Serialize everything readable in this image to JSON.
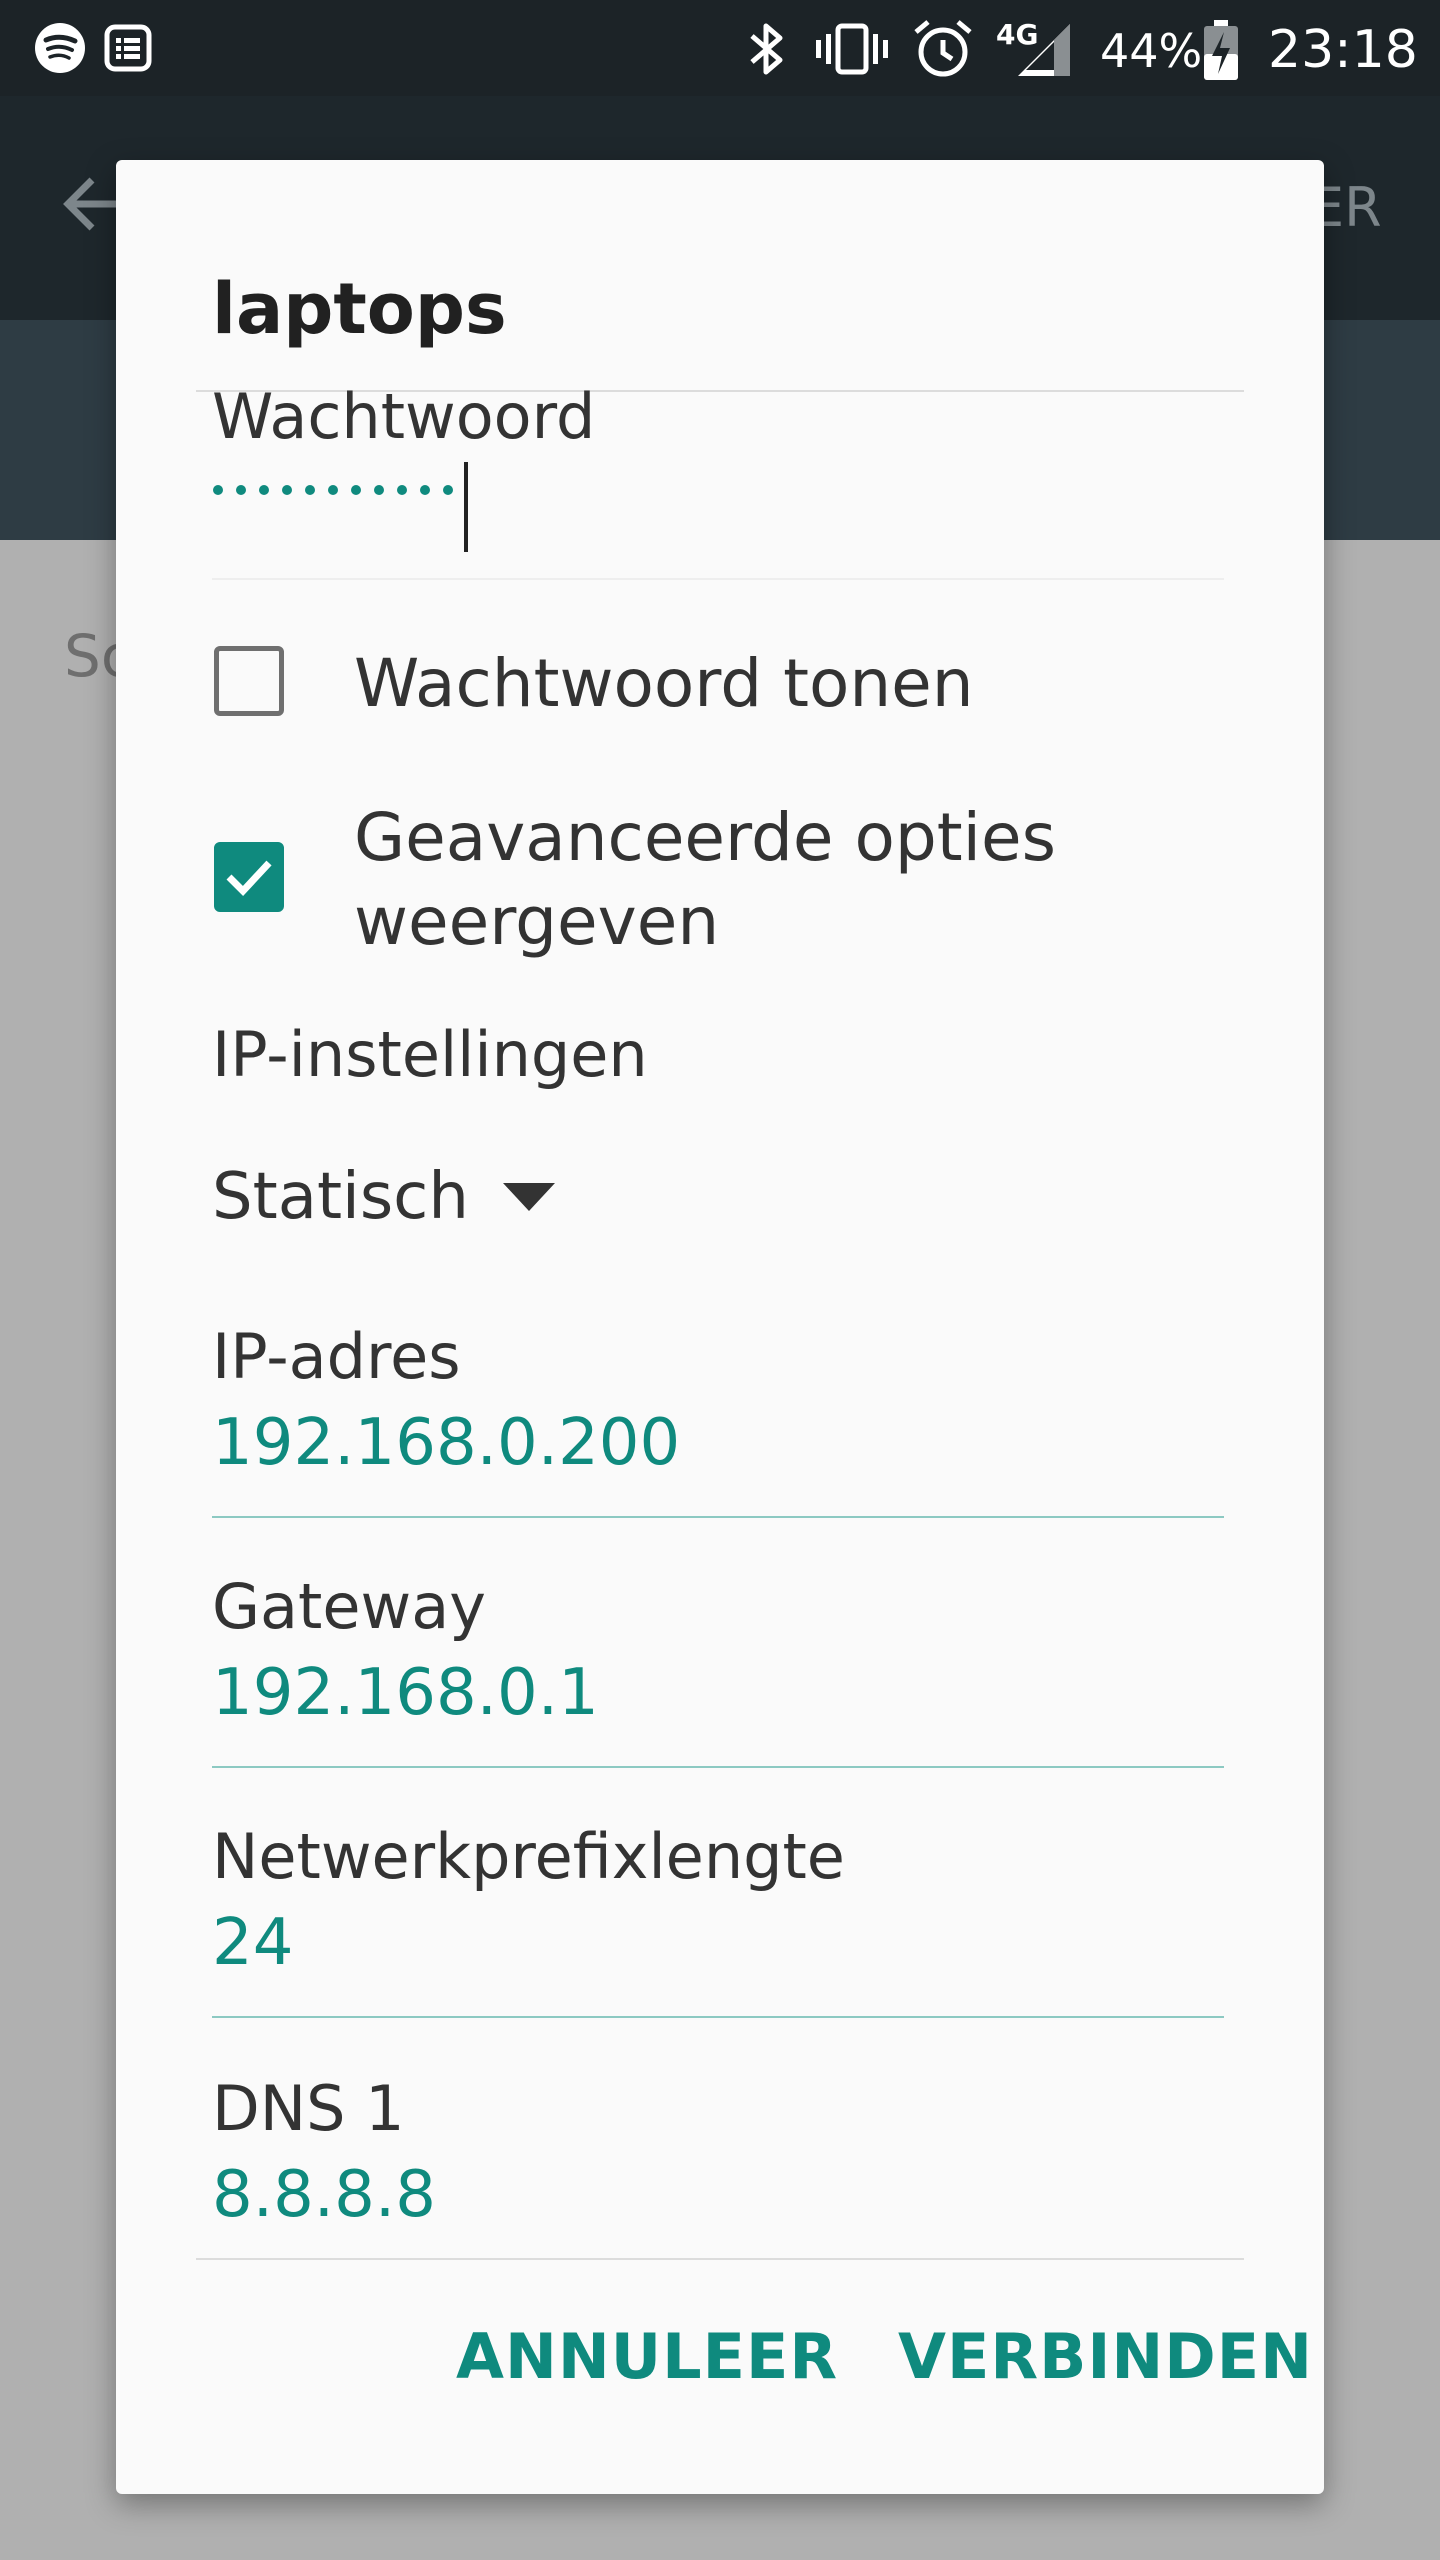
{
  "status_bar": {
    "battery": "44%",
    "time": "23:18",
    "network": "4G",
    "icons": [
      "spotify-icon",
      "notes-icon",
      "bluetooth-icon",
      "vibrate-icon",
      "alarm-icon",
      "signal-icon",
      "battery-charging-icon"
    ]
  },
  "app_bar": {
    "action_partial": "ER",
    "background_label_partial": "Sc"
  },
  "dialog": {
    "title": "laptops",
    "password": {
      "label": "Wachtwoord",
      "masked_value": "•••••••••••"
    },
    "show_password": {
      "label": "Wachtwoord tonen",
      "checked": false
    },
    "advanced_options": {
      "label_line1": "Geavanceerde opties",
      "label_line2": "weergeven",
      "checked": true
    },
    "ip_settings": {
      "label": "IP-instellingen",
      "selected": "Statisch"
    },
    "ip_address": {
      "label": "IP-adres",
      "value": "192.168.0.200"
    },
    "gateway": {
      "label": "Gateway",
      "value": "192.168.0.1"
    },
    "prefix_length": {
      "label": "Netwerkprefixlengte",
      "value": "24"
    },
    "dns1": {
      "label": "DNS 1",
      "value": "8.8.8.8"
    },
    "buttons": {
      "cancel": "ANNULEER",
      "connect": "VERBINDEN"
    }
  },
  "colors": {
    "accent": "#0f8a7e",
    "status_bar": "#1c2327",
    "dialog_bg": "#fafafa",
    "scrim": "#b0b0b0"
  }
}
